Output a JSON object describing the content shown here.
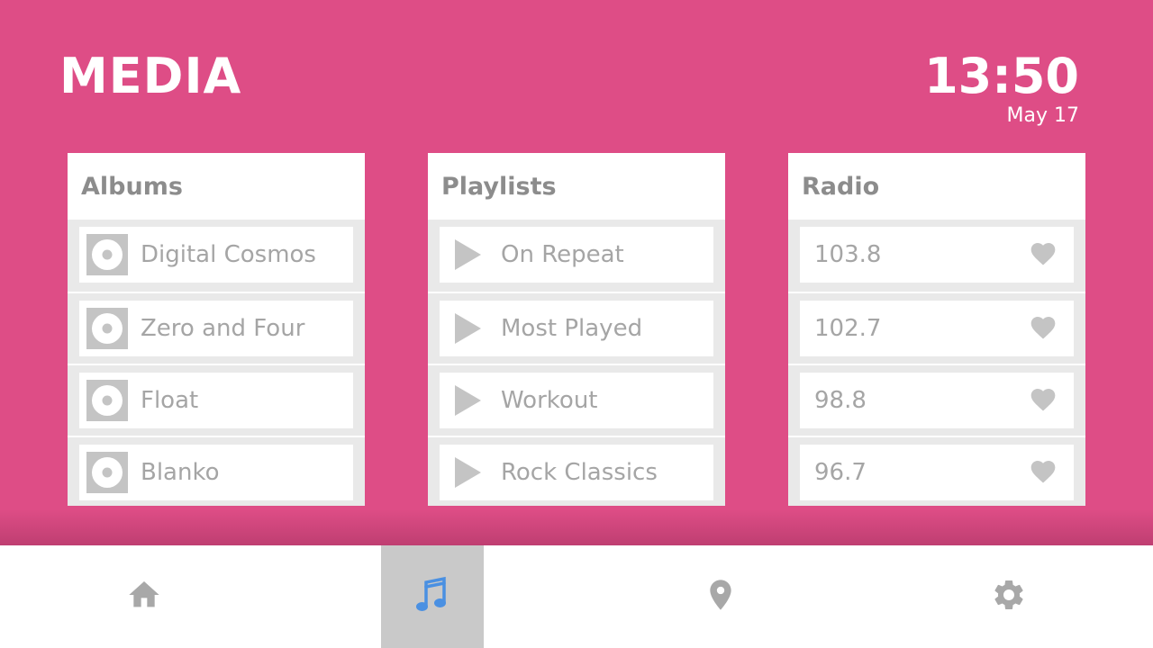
{
  "header": {
    "title": "MEDIA",
    "time": "13:50",
    "date": "May 17"
  },
  "albums": {
    "title": "Albums",
    "items": [
      {
        "label": "Digital Cosmos",
        "icon": "disc-icon"
      },
      {
        "label": "Zero and Four",
        "icon": "disc-icon"
      },
      {
        "label": "Float",
        "icon": "disc-icon"
      },
      {
        "label": "Blanko",
        "icon": "disc-icon"
      }
    ]
  },
  "playlists": {
    "title": "Playlists",
    "items": [
      {
        "label": "On Repeat",
        "icon": "play-icon"
      },
      {
        "label": "Most Played",
        "icon": "play-icon"
      },
      {
        "label": "Workout",
        "icon": "play-icon"
      },
      {
        "label": "Rock Classics",
        "icon": "play-icon"
      }
    ]
  },
  "radio": {
    "title": "Radio",
    "items": [
      {
        "label": "103.8",
        "icon": "heart-icon"
      },
      {
        "label": "102.7",
        "icon": "heart-icon"
      },
      {
        "label": "98.8",
        "icon": "heart-icon"
      },
      {
        "label": "96.7",
        "icon": "heart-icon"
      }
    ]
  },
  "nav": {
    "items": [
      {
        "name": "home",
        "icon": "home-icon",
        "active": false
      },
      {
        "name": "music",
        "icon": "music-note-icon",
        "active": true
      },
      {
        "name": "location",
        "icon": "map-pin-icon",
        "active": false
      },
      {
        "name": "settings",
        "icon": "gear-icon",
        "active": false
      }
    ]
  },
  "colors": {
    "background": "#DE4D86",
    "panel_text": "#8c8c8c",
    "item_text": "#a5a5a5",
    "icon_gray": "#c4c4c4",
    "nav_icon": "#a0a0a0",
    "nav_active_icon": "#4A90E2",
    "nav_active_bg": "#c9c9c9"
  }
}
